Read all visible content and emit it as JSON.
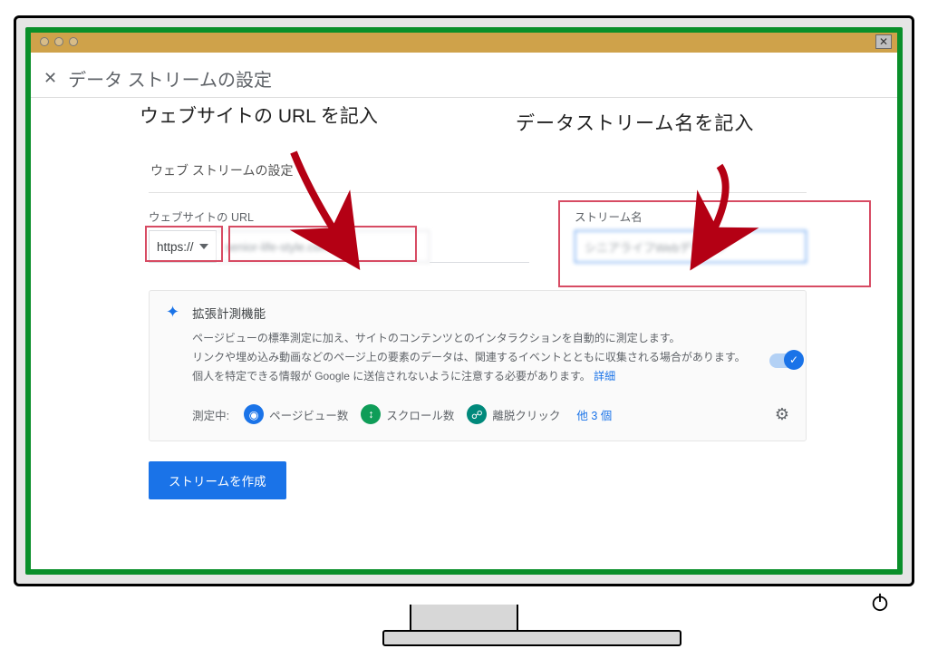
{
  "header": {
    "title": "データ ストリームの設定"
  },
  "callout": {
    "url": "ウェブサイトの URL を記入",
    "stream_name": "データストリーム名を記入"
  },
  "card": {
    "section_title": "ウェブ ストリームの設定",
    "url_label": "ウェブサイトの URL",
    "proto": "https://",
    "url_value": "senior-life-style.com/",
    "stream_label": "ストリーム名",
    "stream_value": "シニアライフWebデザイン"
  },
  "enhanced": {
    "title": "拡張計測機能",
    "desc_line1": "ページビューの標準測定に加え、サイトのコンテンツとのインタラクションを自動的に測定します。",
    "desc_line2": "リンクや埋め込み動画などのページ上の要素のデータは、関連するイベントとともに収集される場合があります。個人を特定できる情報が Google に送信されないように注意する必要があります。",
    "detail_link": "詳細",
    "measuring_label": "測定中:",
    "chips": [
      {
        "icon": "eye",
        "label": "ページビュー数"
      },
      {
        "icon": "scroll",
        "label": "スクロール数"
      },
      {
        "icon": "click",
        "label": "離脱クリック"
      }
    ],
    "more": "他 3 個"
  },
  "buttons": {
    "create": "ストリームを作成"
  }
}
